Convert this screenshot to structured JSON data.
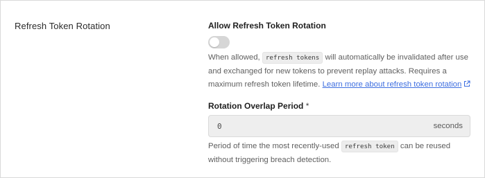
{
  "section": {
    "title": "Refresh Token Rotation"
  },
  "allow_rotation": {
    "label": "Allow Refresh Token Rotation",
    "enabled": false,
    "desc_part1": "When allowed, ",
    "desc_code": "refresh tokens",
    "desc_part2": " will automatically be invalidated after use and exchanged for new tokens to prevent replay attacks. Requires a maximum refresh token lifetime. ",
    "learn_more_link": "Learn more about refresh token rotation",
    "link_icon": "external-link-icon"
  },
  "overlap_period": {
    "label": "Rotation Overlap Period",
    "required_mark": "*",
    "value": "0",
    "unit": "seconds",
    "help_part1": "Period of time the most recently-used ",
    "help_code": "refresh token",
    "help_part2": " can be reused without triggering breach detection."
  },
  "colors": {
    "link": "#3d6ee0",
    "toggle_off": "#d6d6d6",
    "input_bg": "#eeeeee"
  }
}
